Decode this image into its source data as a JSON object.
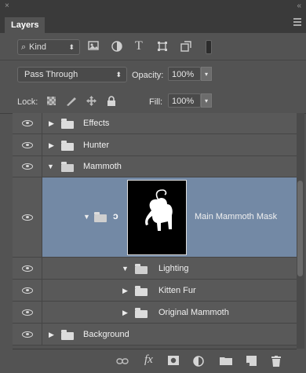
{
  "panel": {
    "close_glyph": "×",
    "collapse_glyph": "«",
    "tab_label": "Layers"
  },
  "filter": {
    "kind_label": "Kind",
    "kind_icon": "search-icon",
    "icons": [
      "image-filter-icon",
      "adjustment-filter-icon",
      "type-filter-icon",
      "shape-filter-icon",
      "smart-object-filter-icon"
    ]
  },
  "blend": {
    "mode": "Pass Through",
    "opacity_label": "Opacity:",
    "opacity_value": "100%"
  },
  "lock": {
    "label": "Lock:",
    "fill_label": "Fill:",
    "fill_value": "100%"
  },
  "layers": [
    {
      "name": "Effects",
      "expanded": false,
      "indent": 0
    },
    {
      "name": "Hunter",
      "expanded": false,
      "indent": 0
    },
    {
      "name": "Mammoth",
      "expanded": true,
      "indent": 0
    },
    {
      "name": "Main Mammoth Mask",
      "selected": true,
      "indent": 1
    },
    {
      "name": "Lighting",
      "expanded": true,
      "indent": 2
    },
    {
      "name": "Kitten Fur",
      "expanded": false,
      "indent": 2
    },
    {
      "name": "Original Mammoth",
      "expanded": false,
      "indent": 2
    },
    {
      "name": "Background",
      "expanded": false,
      "indent": 0
    }
  ],
  "bottom_icons": [
    "link-layers-icon",
    "fx-icon",
    "add-mask-icon",
    "new-adjustment-icon",
    "new-group-icon",
    "new-layer-icon",
    "delete-layer-icon"
  ],
  "bottom_fx_label": "fx",
  "colors": {
    "panel_bg": "#535353",
    "selected_row": "#7389a5",
    "header_bg": "#3a3a3a"
  }
}
